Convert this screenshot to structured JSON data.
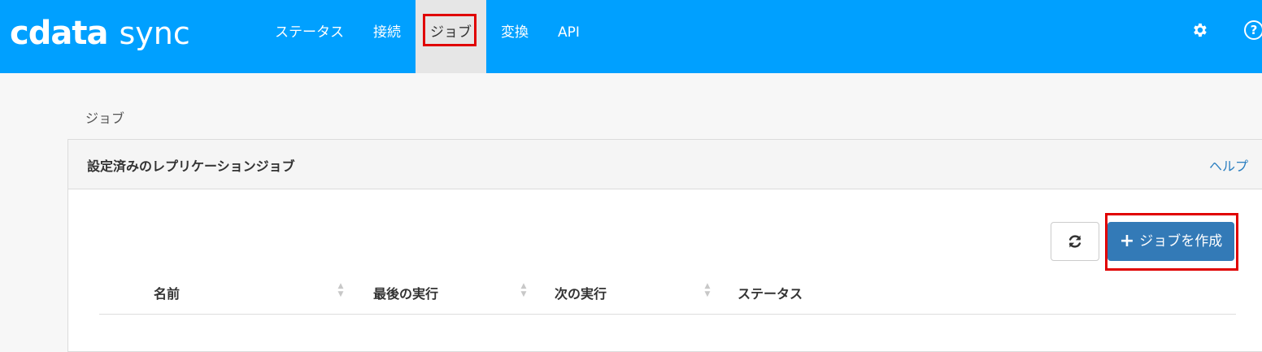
{
  "header": {
    "brand": "cdata",
    "product": "sync",
    "nav": [
      {
        "label": "ステータス",
        "active": false
      },
      {
        "label": "接続",
        "active": false
      },
      {
        "label": "ジョブ",
        "active": true
      },
      {
        "label": "変換",
        "active": false
      },
      {
        "label": "API",
        "active": false
      }
    ],
    "icons": [
      "gear-icon",
      "help-circle-icon"
    ],
    "help_glyph": "?"
  },
  "breadcrumb": "ジョブ",
  "panel": {
    "title": "設定済みのレプリケーションジョブ",
    "help_link": "ヘルプ",
    "refresh_icon": "refresh-icon",
    "create_button": {
      "icon": "plus-icon",
      "plus": "+",
      "label": "ジョブを作成"
    },
    "columns": [
      "名前",
      "最後の実行",
      "次の実行",
      "ステータス"
    ]
  },
  "colors": {
    "topbar": "#00a0ff",
    "active_tab": "#e6e6e6",
    "primary_button": "#337ab7",
    "link": "#2a7ec0",
    "highlight": "#e00000"
  }
}
